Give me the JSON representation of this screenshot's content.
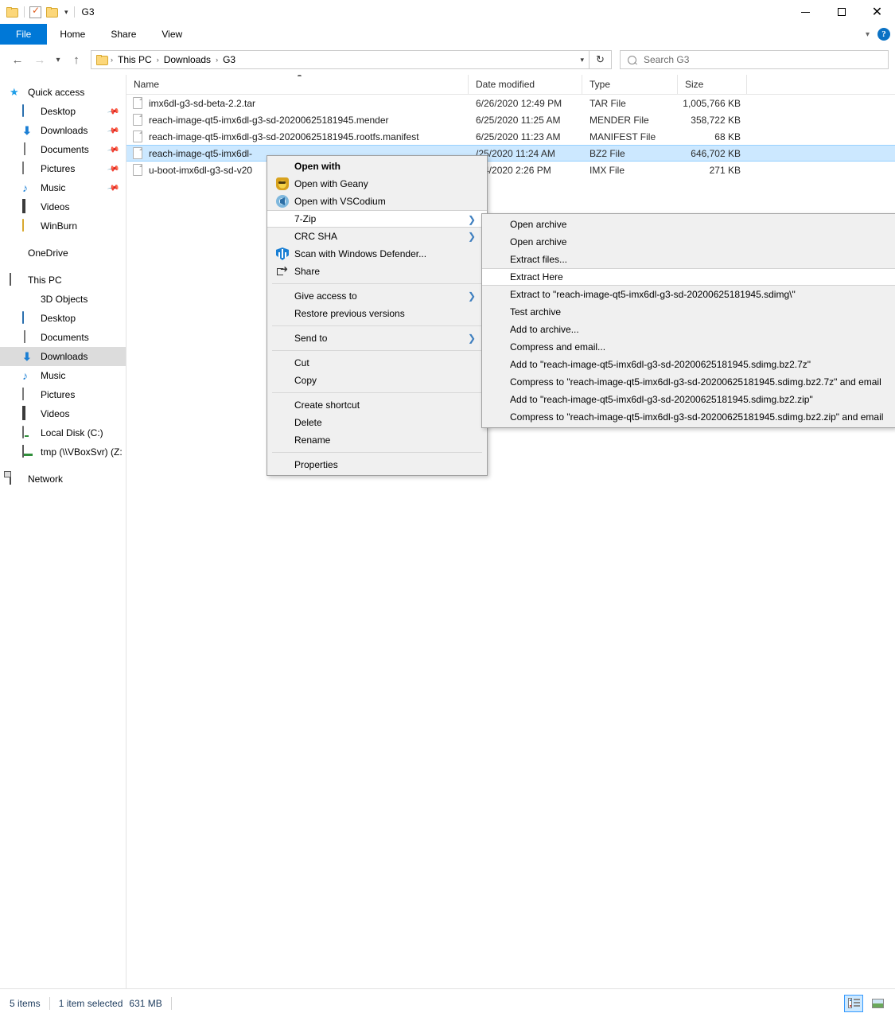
{
  "titlebar": {
    "title": "G3",
    "quick_access": [
      "folder-icon",
      "properties-icon",
      "new-folder-icon",
      "customize-chevron-icon"
    ],
    "minimize": "—",
    "maximize": "☐",
    "close": "✕"
  },
  "ribbon": {
    "tabs": [
      {
        "label": "File",
        "active": true
      },
      {
        "label": "Home",
        "active": false
      },
      {
        "label": "Share",
        "active": false
      },
      {
        "label": "View",
        "active": false
      }
    ],
    "expand_chevron": "ˇ",
    "help_label": "?"
  },
  "addressbar": {
    "back": "←",
    "forward": "→",
    "recent": "ˇ",
    "up": "↑",
    "breadcrumbs": [
      "This PC",
      "Downloads",
      "G3"
    ],
    "separator": "›",
    "dropdown": "ˇ",
    "refresh": "↻"
  },
  "search": {
    "placeholder": "Search G3",
    "value": ""
  },
  "navpane": {
    "groups": [
      {
        "header": {
          "label": "Quick access",
          "icon": "star-icon"
        },
        "items": [
          {
            "label": "Desktop",
            "icon": "desktop-icon",
            "pinned": true
          },
          {
            "label": "Downloads",
            "icon": "download-icon",
            "pinned": true
          },
          {
            "label": "Documents",
            "icon": "documents-icon",
            "pinned": true
          },
          {
            "label": "Pictures",
            "icon": "pictures-icon",
            "pinned": true
          },
          {
            "label": "Music",
            "icon": "music-icon",
            "pinned": true
          },
          {
            "label": "Videos",
            "icon": "videos-icon",
            "pinned": false
          },
          {
            "label": "WinBurn",
            "icon": "folder-icon",
            "pinned": false
          }
        ]
      },
      {
        "header": {
          "label": "OneDrive",
          "icon": "cloud-icon"
        },
        "items": []
      },
      {
        "header": {
          "label": "This PC",
          "icon": "pc-icon"
        },
        "items": [
          {
            "label": "3D Objects",
            "icon": "cube-icon",
            "selected": false
          },
          {
            "label": "Desktop",
            "icon": "desktop-icon",
            "selected": false
          },
          {
            "label": "Documents",
            "icon": "documents-icon",
            "selected": false
          },
          {
            "label": "Downloads",
            "icon": "download-icon",
            "selected": true
          },
          {
            "label": "Music",
            "icon": "music-icon",
            "selected": false
          },
          {
            "label": "Pictures",
            "icon": "pictures-icon",
            "selected": false
          },
          {
            "label": "Videos",
            "icon": "videos-icon",
            "selected": false
          },
          {
            "label": "Local Disk (C:)",
            "icon": "disk-icon",
            "selected": false
          },
          {
            "label": "tmp (\\\\VBoxSvr) (Z:",
            "icon": "network-drive-icon",
            "selected": false
          }
        ]
      },
      {
        "header": {
          "label": "Network",
          "icon": "network-icon"
        },
        "items": []
      }
    ]
  },
  "filelist": {
    "columns": [
      {
        "label": "Name",
        "sorted": "asc"
      },
      {
        "label": "Date modified",
        "sorted": null
      },
      {
        "label": "Type",
        "sorted": null
      },
      {
        "label": "Size",
        "sorted": null
      }
    ],
    "sort_caret": "▲",
    "rows": [
      {
        "name": "imx6dl-g3-sd-beta-2.2.tar",
        "date": "6/26/2020 12:49 PM",
        "type": "TAR File",
        "size": "1,005,766 KB",
        "selected": false
      },
      {
        "name": "reach-image-qt5-imx6dl-g3-sd-20200625181945.mender",
        "date": "6/25/2020 11:25 AM",
        "type": "MENDER File",
        "size": "358,722 KB",
        "selected": false
      },
      {
        "name": "reach-image-qt5-imx6dl-g3-sd-20200625181945.rootfs.manifest",
        "date": "6/25/2020 11:23 AM",
        "type": "MANIFEST File",
        "size": "68 KB",
        "selected": false
      },
      {
        "name": "reach-image-qt5-imx6dl-",
        "date": "/25/2020 11:24 AM",
        "type": "BZ2 File",
        "size": "646,702 KB",
        "selected": true
      },
      {
        "name": "u-boot-imx6dl-g3-sd-v20",
        "date": "/24/2020 2:26 PM",
        "type": "IMX File",
        "size": "271 KB",
        "selected": false
      }
    ]
  },
  "contextmenu": {
    "items": [
      {
        "label": "Open with",
        "bold": true,
        "icon": null,
        "arrow": false,
        "highlighted": false
      },
      {
        "label": "Open with Geany",
        "bold": false,
        "icon": "geany-icon",
        "arrow": false,
        "highlighted": false
      },
      {
        "label": "Open with VSCodium",
        "bold": false,
        "icon": "vscodium-icon",
        "arrow": false,
        "highlighted": false
      },
      {
        "label": "7-Zip",
        "bold": false,
        "icon": null,
        "arrow": true,
        "highlighted": true
      },
      {
        "label": "CRC SHA",
        "bold": false,
        "icon": null,
        "arrow": true,
        "highlighted": false
      },
      {
        "label": "Scan with Windows Defender...",
        "bold": false,
        "icon": "defender-shield-icon",
        "arrow": false,
        "highlighted": false
      },
      {
        "label": "Share",
        "bold": false,
        "icon": "share-icon",
        "arrow": false,
        "highlighted": false
      },
      {
        "separator": true
      },
      {
        "label": "Give access to",
        "bold": false,
        "icon": null,
        "arrow": true,
        "highlighted": false
      },
      {
        "label": "Restore previous versions",
        "bold": false,
        "icon": null,
        "arrow": false,
        "highlighted": false
      },
      {
        "separator": true
      },
      {
        "label": "Send to",
        "bold": false,
        "icon": null,
        "arrow": true,
        "highlighted": false
      },
      {
        "separator": true
      },
      {
        "label": "Cut",
        "bold": false,
        "icon": null,
        "arrow": false,
        "highlighted": false
      },
      {
        "label": "Copy",
        "bold": false,
        "icon": null,
        "arrow": false,
        "highlighted": false
      },
      {
        "separator": true
      },
      {
        "label": "Create shortcut",
        "bold": false,
        "icon": null,
        "arrow": false,
        "highlighted": false
      },
      {
        "label": "Delete",
        "bold": false,
        "icon": null,
        "arrow": false,
        "highlighted": false
      },
      {
        "label": "Rename",
        "bold": false,
        "icon": null,
        "arrow": false,
        "highlighted": false
      },
      {
        "separator": true
      },
      {
        "label": "Properties",
        "bold": false,
        "icon": null,
        "arrow": false,
        "highlighted": false
      }
    ]
  },
  "submenu": {
    "title": "7-Zip",
    "items": [
      {
        "label": "Open archive",
        "highlighted": false
      },
      {
        "label": "Open archive",
        "highlighted": false
      },
      {
        "label": "Extract files...",
        "highlighted": false
      },
      {
        "label": "Extract Here",
        "highlighted": true
      },
      {
        "label": "Extract to \"reach-image-qt5-imx6dl-g3-sd-20200625181945.sdimg\\\"",
        "highlighted": false
      },
      {
        "label": "Test archive",
        "highlighted": false
      },
      {
        "label": "Add to archive...",
        "highlighted": false
      },
      {
        "label": "Compress and email...",
        "highlighted": false
      },
      {
        "label": "Add to \"reach-image-qt5-imx6dl-g3-sd-20200625181945.sdimg.bz2.7z\"",
        "highlighted": false
      },
      {
        "label": "Compress to \"reach-image-qt5-imx6dl-g3-sd-20200625181945.sdimg.bz2.7z\" and email",
        "highlighted": false
      },
      {
        "label": "Add to \"reach-image-qt5-imx6dl-g3-sd-20200625181945.sdimg.bz2.zip\"",
        "highlighted": false
      },
      {
        "label": "Compress to \"reach-image-qt5-imx6dl-g3-sd-20200625181945.sdimg.bz2.zip\" and email",
        "highlighted": false
      }
    ]
  },
  "statusbar": {
    "item_count": "5 items",
    "selection": "1 item selected",
    "selection_size": "631 MB",
    "views": [
      {
        "name": "details-view",
        "active": true
      },
      {
        "name": "large-icons-view",
        "active": false
      }
    ]
  },
  "colors": {
    "accent": "#0078d7",
    "selection": "#cce8ff",
    "selection_border": "#99d1ff",
    "menu_bg": "#f0f0f0",
    "nav_selected": "#dcdcdc"
  }
}
